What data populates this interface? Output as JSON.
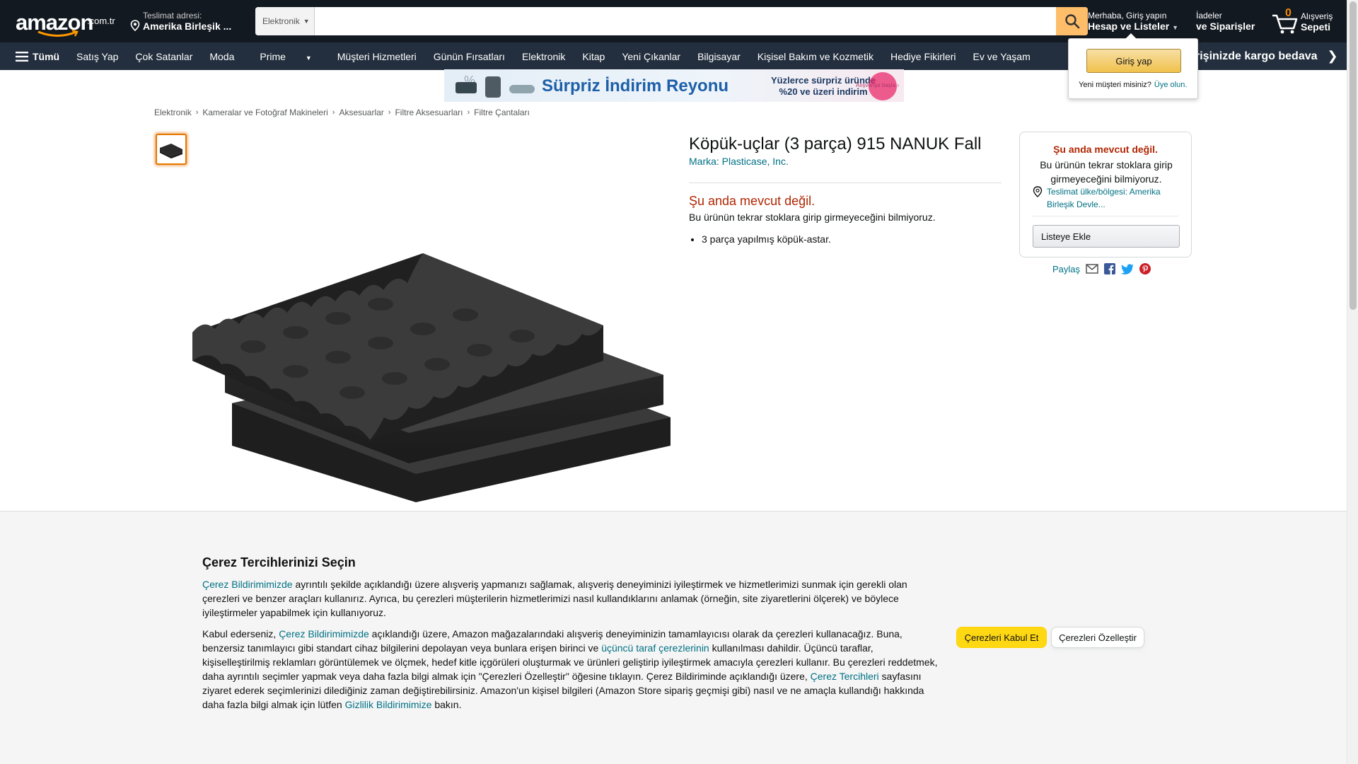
{
  "header": {
    "logo_word": "amazon",
    "logo_tld": ".com.tr",
    "deliver_line1": "Teslimat adresi:",
    "deliver_line2": "Amerika Birleşik ...",
    "search_category": "Elektronik",
    "search_value": "",
    "account_line1": "Merhaba, Giriş yapın",
    "account_line2": "Hesap ve Listeler",
    "orders_line1": "İadeler",
    "orders_line2": "ve Siparişler",
    "cart_count": "0",
    "cart_line1": "Alışveriş",
    "cart_line2": "Sepeti"
  },
  "nav": {
    "all_label": "Tümü",
    "links": [
      "Satış Yap",
      "Çok Satanlar",
      "Moda",
      "Prime",
      "Müşteri Hizmetleri",
      "Günün Fırsatları",
      "Elektronik",
      "Kitap",
      "Yeni Çıkanlar",
      "Bilgisayar",
      "Kişisel Bakım ve Kozmetik",
      "Hediye Fikirleri",
      "Ev ve Yaşam"
    ],
    "promo": "rişinizde kargo bedava",
    "promo_chevron": "❯"
  },
  "flyout": {
    "signin_label": "Giriş yap",
    "new_customer": "Yeni müşteri misiniz?",
    "signup_link": "Üye olun."
  },
  "banner": {
    "headline": "Sürpriz İndirim Reyonu",
    "sub_line1": "Yüzlerce sürpriz üründe",
    "sub_line2": "%20 ve üzeri indirim",
    "cta": "Alışverişe başla ›"
  },
  "breadcrumb": [
    "Elektronik",
    "Kameralar ve Fotoğraf Makineleri",
    "Aksesuarlar",
    "Filtre Aksesuarları",
    "Filtre Çantaları"
  ],
  "product": {
    "title": "Köpük-uçlar (3 parça) 915 NANUK Fall",
    "brand": "Marka: Plasticase, Inc.",
    "availability": "Şu anda mevcut değil.",
    "availability_note": "Bu ürünün tekrar stoklara girip girmeyeceğini bilmiyoruz.",
    "bullets": [
      "3 parça yapılmış köpük-astar."
    ]
  },
  "buybox": {
    "availability": "Şu anda mevcut değil.",
    "note": "Bu ürünün tekrar stoklara girip girmeyeceğini bilmiyoruz.",
    "location": "Teslimat ülke/bölgesi: Amerika Birleşik Devle...",
    "add_to_list": "Listeye Ekle",
    "share_label": "Paylaş"
  },
  "cookie": {
    "heading": "Çerez Tercihlerinizi Seçin",
    "p1_link": "Çerez Bildirimimizde",
    "p1_text": " ayrıntılı şekilde açıklandığı üzere alışveriş yapmanızı sağlamak, alışveriş deneyiminizi iyileştirmek ve hizmetlerimizi sunmak için gerekli olan çerezleri ve benzer araçları kullanırız. Ayrıca, bu çerezleri müşterilerin hizmetlerimizi nasıl kullandıklarını anlamak (örneğin, site ziyaretlerini ölçerek) ve böylece iyileştirmeler yapabilmek için kullanıyoruz.",
    "p2_a": "Kabul ederseniz, ",
    "p2_link1": "Çerez Bildirimimizde",
    "p2_b": " açıklandığı üzere, Amazon mağazalarındaki alışveriş deneyiminizin tamamlayıcısı olarak da çerezleri kullanacağız. Buna, benzersiz tanımlayıcı gibi standart cihaz bilgilerini depolayan veya bunlara erişen birinci ve ",
    "p2_link2": "üçüncü taraf çerezlerinin",
    "p2_c": " kullanılması dahildir. Üçüncü taraflar, kişiselleştirilmiş reklamları görüntülemek ve ölçmek, hedef kitle içgörüleri oluşturmak ve ürünleri geliştirip iyileştirmek amacıyla çerezleri kullanır. Bu çerezleri reddetmek, daha ayrıntılı seçimler yapmak veya daha fazla bilgi almak için \"Çerezleri Özelleştir\" öğesine tıklayın. Çerez Bildiriminde açıklandığı üzere, ",
    "p2_link3": "Çerez Tercihleri",
    "p2_d": " sayfasını ziyaret ederek seçimlerinizi dilediğiniz zaman değiştirebilirsiniz. Amazon'un kişisel bilgileri (Amazon Store sipariş geçmişi gibi) nasıl ve ne amaçla kullandığı hakkında daha fazla bilgi almak için lütfen ",
    "p2_link4": "Gizlilik Bildirimimize",
    "p2_e": " bakın.",
    "accept_label": "Çerezleri Kabul Et",
    "customize_label": "Çerezleri Özelleştir"
  },
  "colors": {
    "nav_dark": "#131921",
    "nav_secondary": "#232f3e",
    "search_button": "#febd69",
    "link": "#007185",
    "unavailable": "#b12704",
    "accept_button": "#ffd814"
  }
}
